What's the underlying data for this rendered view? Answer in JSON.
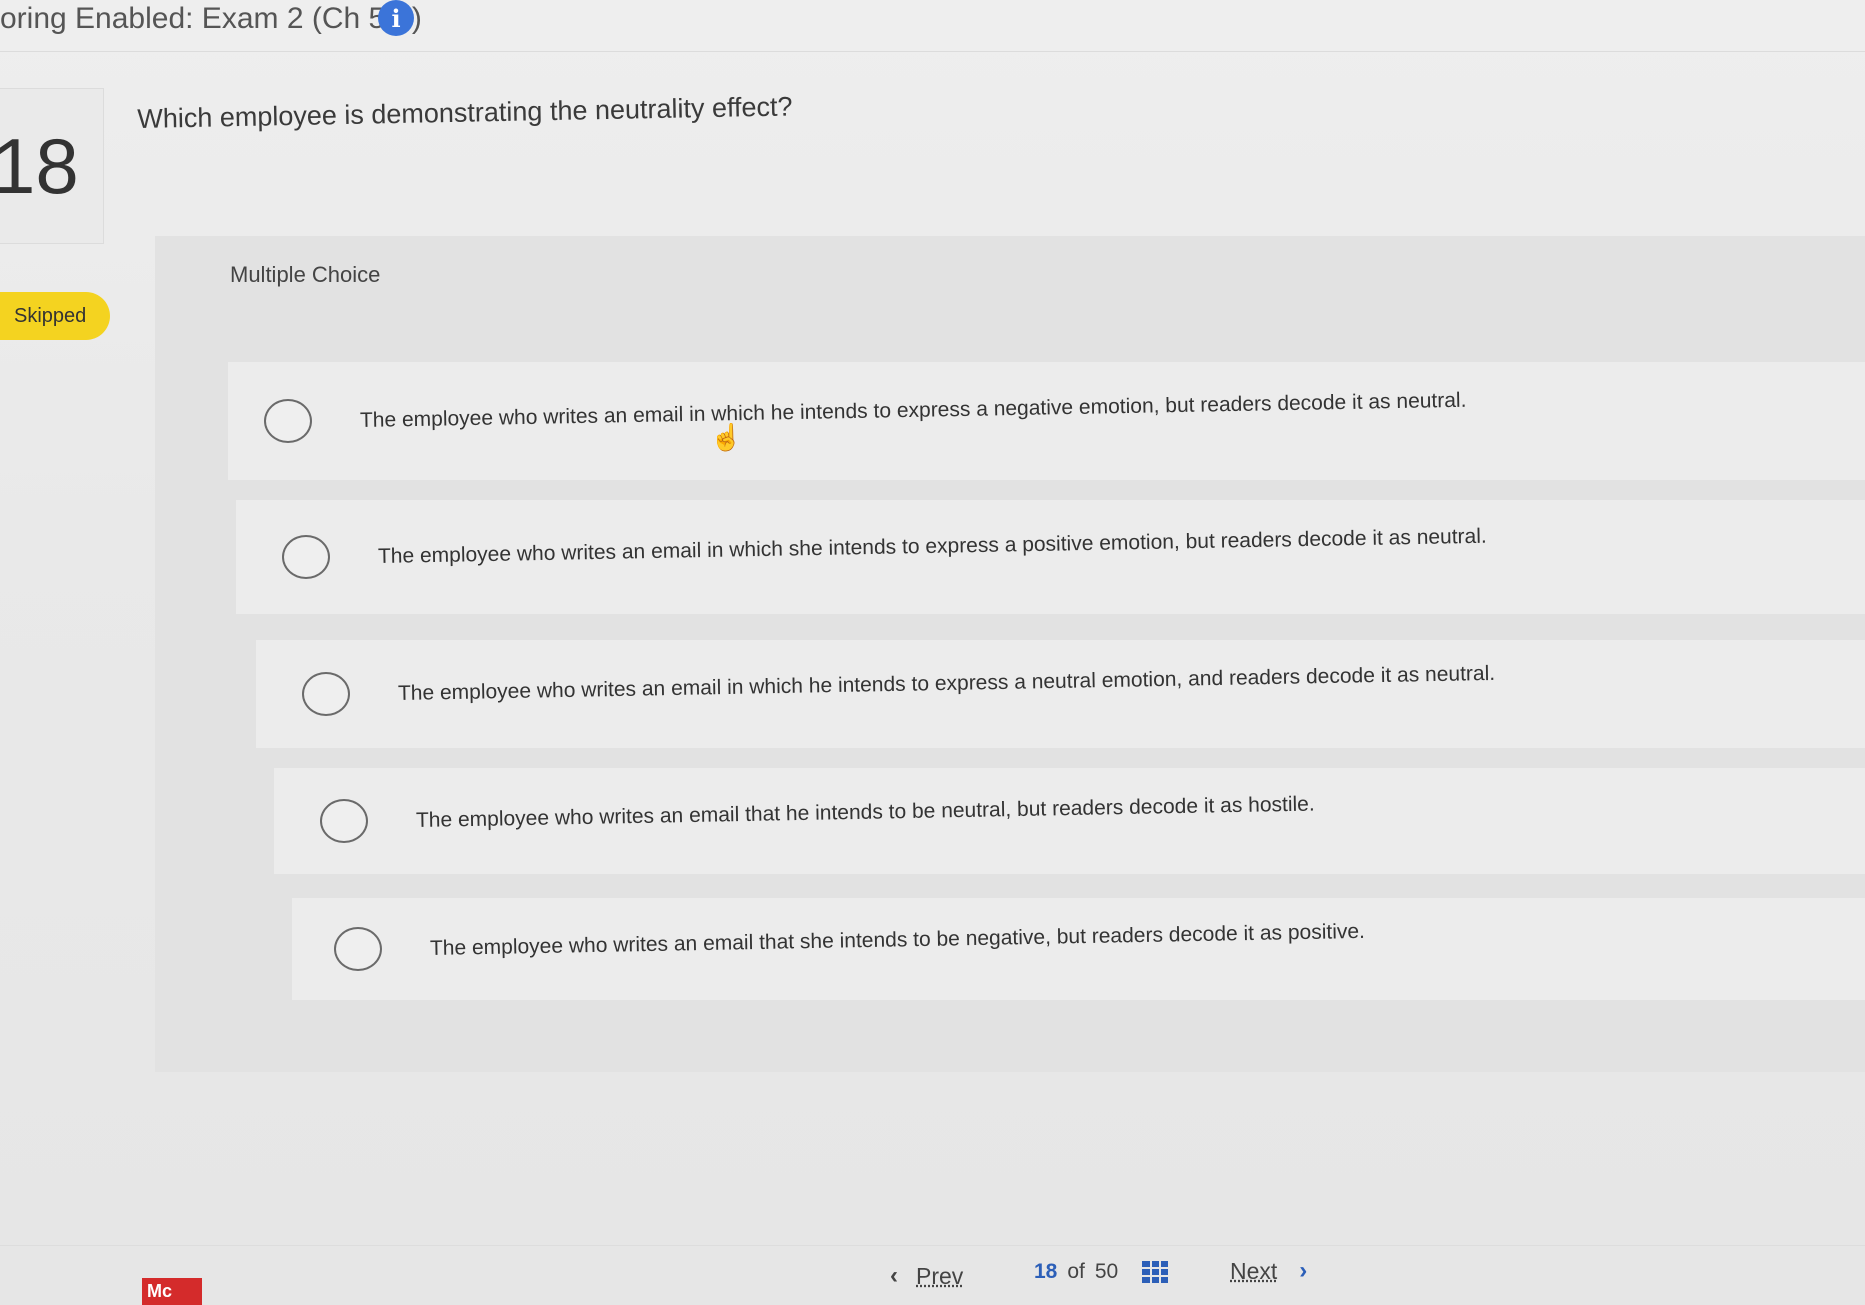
{
  "header": {
    "title": "oring Enabled: Exam 2 (Ch 5-9)",
    "info_icon": "info-icon"
  },
  "question": {
    "number": "18",
    "status": "Skipped",
    "text": "Which employee is demonstrating the neutrality effect?",
    "type_label": "Multiple Choice"
  },
  "options": [
    {
      "text": "The employee who writes an email in which he intends to express a negative emotion, but readers decode it as neutral.",
      "selected": false
    },
    {
      "text": "The employee who writes an email in which she intends to express a positive emotion, but readers decode it as neutral.",
      "selected": false
    },
    {
      "text": "The employee who writes an email in which he intends to express a neutral emotion, and readers decode it as neutral.",
      "selected": false
    },
    {
      "text": "The employee who writes an email that he intends to be neutral, but readers decode it as hostile.",
      "selected": false
    },
    {
      "text": "The employee who writes an email that she intends to be negative, but readers decode it as positive.",
      "selected": false
    }
  ],
  "footer": {
    "logo_text": "Mc",
    "prev_label": "Prev",
    "current_page": "18",
    "of_label": "of",
    "total_pages": "50",
    "next_label": "Next"
  },
  "colors": {
    "skipped_badge": "#f4d320",
    "accent_blue": "#2c5fb8",
    "logo_red": "#d42b2b"
  }
}
